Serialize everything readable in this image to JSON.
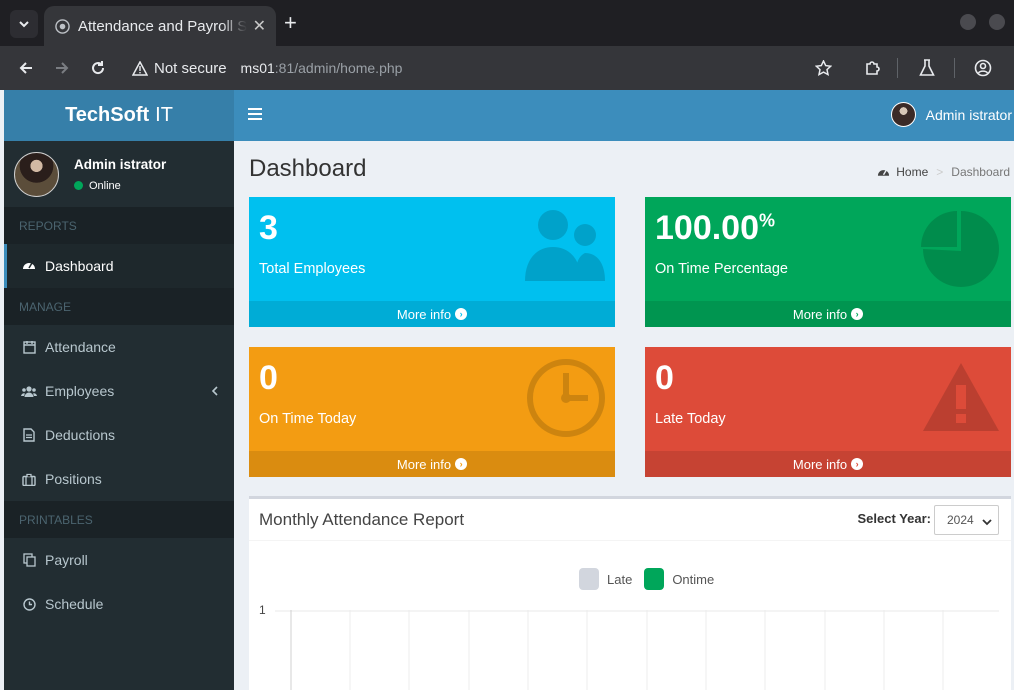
{
  "browser": {
    "tab_title": "Attendance and Payroll System",
    "security_label": "Not secure",
    "url_host": "ms01",
    "url_rest": ":81/admin/home.php"
  },
  "app": {
    "brand_bold": "TechSoft",
    "brand_light": "IT",
    "user_name": "Admin istrator",
    "user_status": "Online"
  },
  "sidebar": {
    "sections": [
      {
        "header": "REPORTS",
        "items": [
          {
            "label": "Dashboard",
            "icon": "dashboard-icon",
            "active": true
          }
        ]
      },
      {
        "header": "MANAGE",
        "items": [
          {
            "label": "Attendance",
            "icon": "calendar-icon"
          },
          {
            "label": "Employees",
            "icon": "users-icon"
          },
          {
            "label": "Deductions",
            "icon": "file-icon"
          },
          {
            "label": "Positions",
            "icon": "suitcase-icon"
          }
        ]
      },
      {
        "header": "PRINTABLES",
        "items": [
          {
            "label": "Payroll",
            "icon": "copy-icon"
          },
          {
            "label": "Schedule",
            "icon": "clock-icon"
          }
        ]
      }
    ]
  },
  "page": {
    "title": "Dashboard",
    "breadcrumb_home": "Home",
    "breadcrumb_current": "Dashboard"
  },
  "stats": [
    {
      "value": "3",
      "suffix": "",
      "label": "Total Employees",
      "footer": "More info",
      "color": "#00c0ef",
      "icon": "users-icon"
    },
    {
      "value": "100.00",
      "suffix": "%",
      "label": "On Time Percentage",
      "footer": "More info",
      "color": "#00a65a",
      "icon": "pie-chart-icon"
    },
    {
      "value": "0",
      "suffix": "",
      "label": "On Time Today",
      "footer": "More info",
      "color": "#f39c12",
      "icon": "clock-icon"
    },
    {
      "value": "0",
      "suffix": "",
      "label": "Late Today",
      "footer": "More info",
      "color": "#dd4b39",
      "icon": "warning-icon"
    }
  ],
  "report": {
    "title": "Monthly Attendance Report",
    "year_label": "Select Year:",
    "year_value": "2024",
    "legend_late": "Late",
    "legend_ontime": "Ontime",
    "y_tick_top": "1"
  }
}
